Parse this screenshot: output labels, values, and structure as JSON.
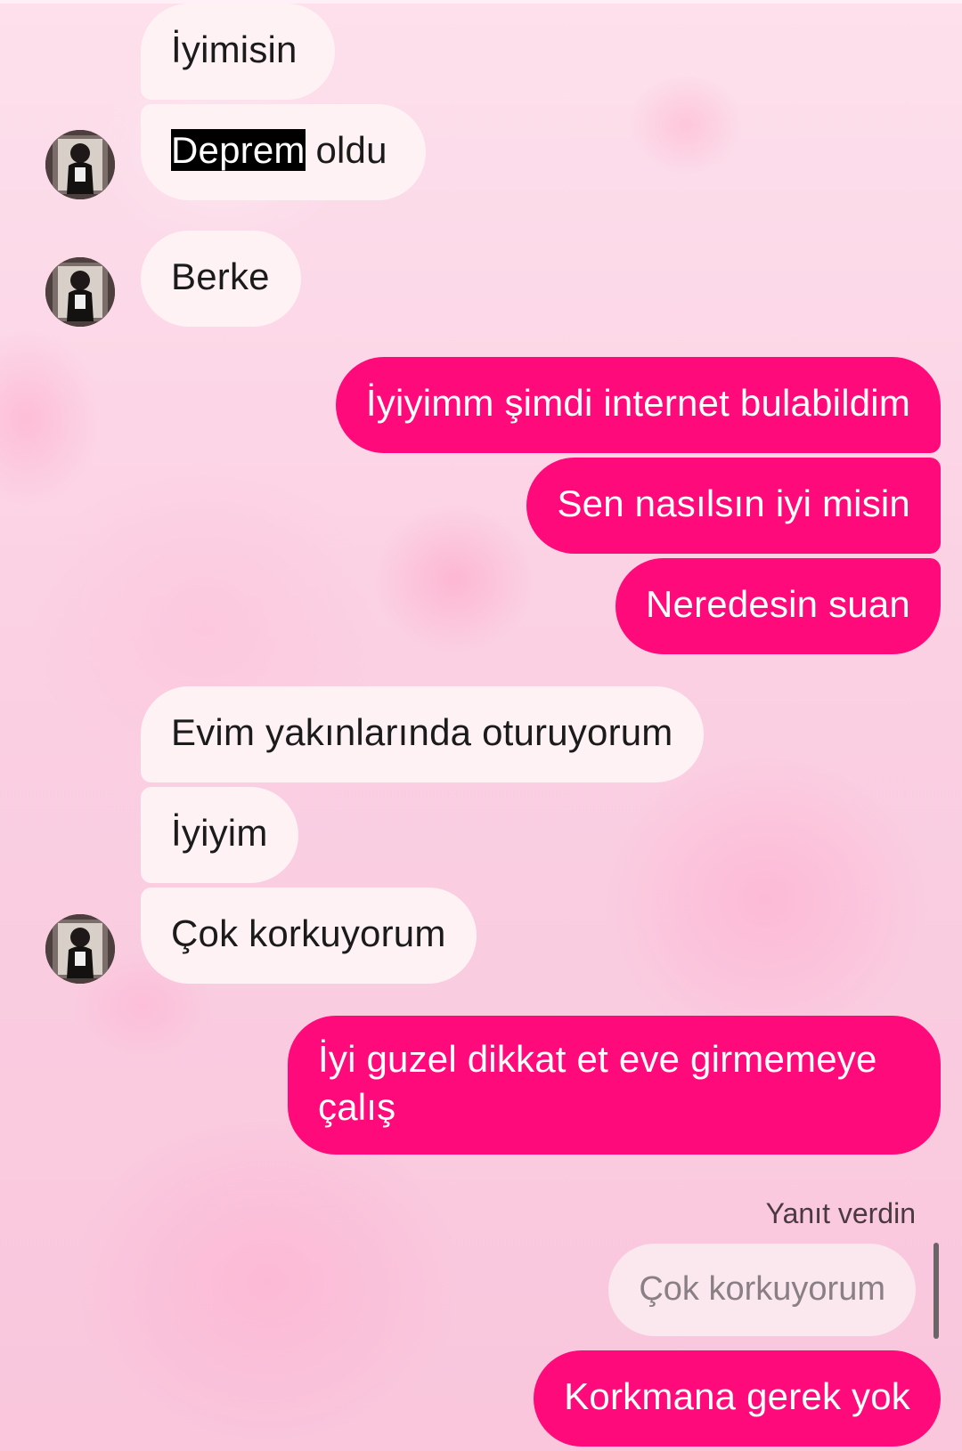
{
  "colors": {
    "incoming_bubble": "#fff2f5",
    "outgoing_bubble": "#ff0a7a",
    "background": "#fbd3e6",
    "reply_bubble": "#fbe8ee"
  },
  "messages": [
    {
      "text": "İyimisin"
    },
    {
      "text_highlighted": "Deprem",
      "text_rest": " oldu"
    },
    {
      "text": "Berke"
    },
    {
      "text": "İyiyimm şimdi internet bulabildim"
    },
    {
      "text": "Sen nasılsın iyi misin"
    },
    {
      "text": "Neredesin suan"
    },
    {
      "text": "Evim yakınlarında oturuyorum"
    },
    {
      "text": "İyiyim"
    },
    {
      "text": "Çok korkuyorum"
    },
    {
      "text": "İyi guzel dikkat et eve girmemeye çalış"
    },
    {
      "text": "Korkmana gerek yok"
    }
  ],
  "reply": {
    "label": "Yanıt verdin",
    "quoted": "Çok korkuyorum"
  },
  "avatar": {
    "icon": "profile-photo-avatar"
  }
}
